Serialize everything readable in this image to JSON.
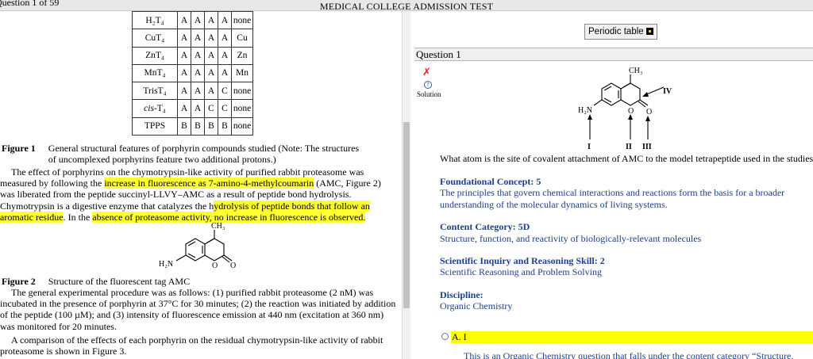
{
  "header": {
    "question_counter": "Question 1 of 59",
    "title": "MEDICAL COLLEGE ADMISSION TEST"
  },
  "table": {
    "rows": [
      {
        "compound": "H₂T₄",
        "v1": "A",
        "v2": "A",
        "v3": "A",
        "v4": "A",
        "ion": "none"
      },
      {
        "compound": "CuT₄",
        "v1": "A",
        "v2": "A",
        "v3": "A",
        "v4": "A",
        "ion": "Cu"
      },
      {
        "compound": "ZnT₄",
        "v1": "A",
        "v2": "A",
        "v3": "A",
        "v4": "A",
        "ion": "Zn"
      },
      {
        "compound": "MnT₄",
        "v1": "A",
        "v2": "A",
        "v3": "A",
        "v4": "A",
        "ion": "Mn"
      },
      {
        "compound": "TrisT₄",
        "v1": "A",
        "v2": "A",
        "v3": "A",
        "v4": "C",
        "ion": "none"
      },
      {
        "compound": "cis-T₄",
        "v1": "A",
        "v2": "A",
        "v3": "C",
        "v4": "C",
        "ion": "none"
      },
      {
        "compound": "TPPS",
        "v1": "B",
        "v2": "B",
        "v3": "B",
        "v4": "B",
        "ion": "none"
      }
    ]
  },
  "figure1": {
    "label": "Figure 1",
    "caption": "General structural features of porphyrin compounds studied (Note: The structures of uncomplexed porphyrins feature two additional protons.)"
  },
  "paragraph1": {
    "p1": "The effect of porphyrins on the chymotrypsin-like activity of purified rabbit proteasome was measured by following the ",
    "h1": "increase in fluorescence as 7-amino-4-methylcoumarin",
    "p2": " (AMC, Figure 2) was liberated from the peptide succinyl-LLVY–AMC as a result of peptide bond hydrolysis. Chymotrypsin is a digestive enzyme that catalyzes the h",
    "h2": "ydrolysis of peptide bonds that follow an aromatic residue",
    "p3": ". In the ",
    "h3": "absence of proteasome activity, no increase in fluorescence is observed",
    "p4": "."
  },
  "structure_labels": {
    "ch3": "CH₃",
    "h2n": "H₂N",
    "o_ring": "O",
    "o_carbonyl": "O"
  },
  "figure2": {
    "label": "Figure 2",
    "caption": "Structure of the fluorescent tag AMC"
  },
  "paragraph2": "The general experimental procedure was as follows: (1) purified rabbit proteasome (2 nM) was incubated in the presence of porphyrin at 37°C for 30 minutes; (2) the reaction was initiated by addition of the peptide (100 µM); and (3) intensity of fluorescence emission at 440 nm (excitation at 360 nm) was monitored for 20 minutes.",
  "paragraph3": "A comparison of the effects of each porphyrin on the residual chymotrypsin-like activity of rabbit proteasome is shown in Figure 3.",
  "right_panel": {
    "periodic_button": "Periodic table",
    "question_header": "Question 1",
    "mark_icon": "✗",
    "solution_icon": "?",
    "solution_label": "Solution",
    "q_structure": {
      "ch3": "CH₃",
      "h2n": "H₂N",
      "o_ring": "O",
      "o_carbonyl": "O",
      "label_I": "I",
      "label_II": "II",
      "label_III": "III",
      "label_IV": "IV"
    },
    "question_text": "What atom is the site of covalent attachment of AMC to the model tetrapeptide used in the studies?",
    "foundational_concept": {
      "heading": "Foundational Concept: 5",
      "text": "The principles that govern chemical interactions and reactions form the basis for a broader understanding of the molecular dynamics of living systems."
    },
    "content_category": {
      "heading": "Content Category: 5D",
      "text": "Structure, function, and reactivity of biologically-relevant molecules"
    },
    "skill": {
      "heading": "Scientific Inquiry and Reasoning Skill: 2",
      "text": "Scientific Reasoning and Problem Solving"
    },
    "discipline": {
      "heading": "Discipline:",
      "text": "Organic Chemistry"
    },
    "choice_a": "A. I",
    "explanation": "This is an Organic Chemistry question that falls under the content category “Structure,"
  },
  "colors": {
    "highlight": "#ffff33",
    "choice_highlight": "#ffff00",
    "meta_text": "#1d3f8a"
  }
}
